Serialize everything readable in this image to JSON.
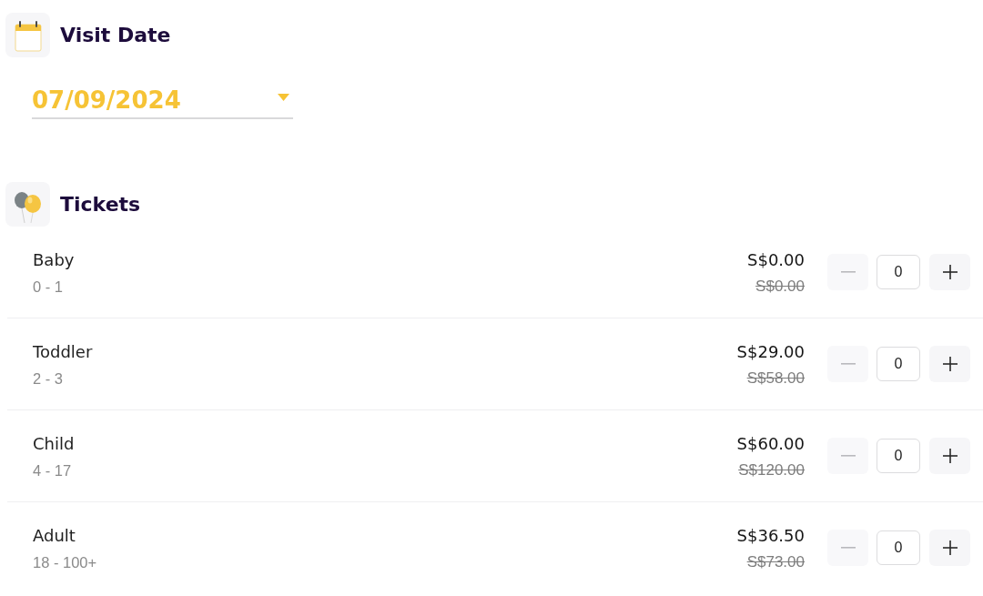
{
  "visit_date": {
    "title": "Visit Date",
    "date": "07/09/2024"
  },
  "tickets": {
    "title": "Tickets",
    "items": [
      {
        "name": "Baby",
        "age_range": "0 - 1",
        "price": "S$0.00",
        "original_price": "S$0.00",
        "quantity": "0",
        "decrease_disabled": true
      },
      {
        "name": "Toddler",
        "age_range": "2 - 3",
        "price": "S$29.00",
        "original_price": "S$58.00",
        "quantity": "0",
        "decrease_disabled": true
      },
      {
        "name": "Child",
        "age_range": "4 - 17",
        "price": "S$60.00",
        "original_price": "S$120.00",
        "quantity": "0",
        "decrease_disabled": true
      },
      {
        "name": "Adult",
        "age_range": "18 - 100+",
        "price": "S$36.50",
        "original_price": "S$73.00",
        "quantity": "0",
        "decrease_disabled": true
      }
    ]
  }
}
